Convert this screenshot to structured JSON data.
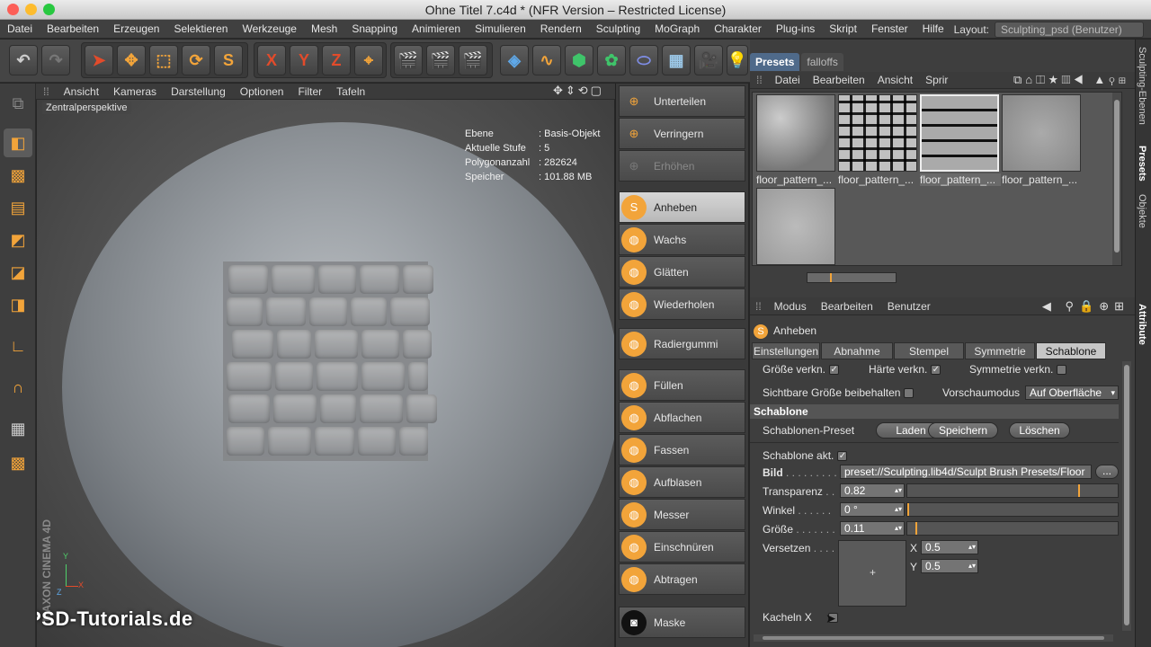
{
  "window": {
    "title": "Ohne Titel 7.c4d * (NFR Version – Restricted License)"
  },
  "menu": [
    "Datei",
    "Bearbeiten",
    "Erzeugen",
    "Selektieren",
    "Werkzeuge",
    "Mesh",
    "Snapping",
    "Animieren",
    "Simulieren",
    "Rendern",
    "Sculpting",
    "MoGraph",
    "Charakter",
    "Plug-ins",
    "Skript",
    "Fenster",
    "Hilfe"
  ],
  "layout": {
    "label": "Layout:",
    "value": "Sculpting_psd (Benutzer)"
  },
  "toolbar": {
    "x": "X",
    "y": "Y",
    "z": "Z"
  },
  "viewport": {
    "menu": [
      "Ansicht",
      "Kameras",
      "Darstellung",
      "Optionen",
      "Filter",
      "Tafeln"
    ],
    "camera": "Zentralperspektive",
    "hud": [
      {
        "k": "Ebene",
        "v": ": Basis-Objekt"
      },
      {
        "k": "Aktuelle Stufe",
        "v": ": 5"
      },
      {
        "k": "Polygonanzahl",
        "v": ": 282624"
      },
      {
        "k": "Speicher",
        "v": ": 101.88 MB"
      }
    ],
    "axes": {
      "y": "Y",
      "x": "X",
      "z": "Z"
    },
    "brand": "MAXON CINEMA 4D",
    "watermark": "PSD-Tutorials.de"
  },
  "sculpt_tools": [
    "Unterteilen",
    "Verringern",
    "Erhöhen",
    "Anheben",
    "Wachs",
    "Glätten",
    "Wiederholen",
    "Radiergummi",
    "Füllen",
    "Abflachen",
    "Fassen",
    "Aufblasen",
    "Messer",
    "Einschnüren",
    "Abtragen",
    "Maske"
  ],
  "active_tool": "Anheben",
  "presets": {
    "tabs": [
      "Presets",
      "falloffs"
    ],
    "menu": [
      "Datei",
      "Bearbeiten",
      "Ansicht",
      "Sprir"
    ],
    "items": [
      "floor_pattern_...",
      "floor_pattern_...",
      "floor_pattern_...",
      "floor_pattern_..."
    ]
  },
  "side_tabs": [
    "Sculpting-Ebenen",
    "Presets",
    "Objekte",
    "Attribute"
  ],
  "attributes": {
    "menu": [
      "Modus",
      "Bearbeiten",
      "Benutzer"
    ],
    "tool_name": "Anheben",
    "tabs": [
      "Einstellungen",
      "Abnahme",
      "Stempel",
      "Symmetrie",
      "Schablone"
    ],
    "active_tab": "Schablone",
    "groesse_verkn": "Größe verkn.",
    "haerte_verkn": "Härte verkn.",
    "symmetrie_verkn": "Symmetrie verkn.",
    "sichtbare": "Sichtbare Größe beibehalten",
    "vorschau_label": "Vorschaumodus",
    "vorschau_value": "Auf Oberfläche",
    "section": "Schablone",
    "preset_label": "Schablonen-Preset",
    "laden": "Laden",
    "speichern": "Speichern",
    "loeschen": "Löschen",
    "schablone_akt": "Schablone akt.",
    "bild_label": "Bild",
    "bild_value": "preset://Sculpting.lib4d/Sculpt Brush Presets/Floor",
    "browse": "...",
    "transparenz_label": "Transparenz",
    "transparenz": "0.82",
    "transparenz_level": 0.82,
    "winkel_label": "Winkel",
    "winkel": "0 °",
    "winkel_level": 0,
    "groesse_label": "Größe",
    "groesse": "0.11",
    "groesse_level": 0.04,
    "versetzen_label": "Versetzen",
    "x_label": "X",
    "x_value": "0.5",
    "y_label": "Y",
    "y_value": "0.5",
    "kacheln_label": "Kacheln X"
  },
  "colors": {
    "accent": "#f2a43a",
    "tab_active": "#4f6a8a"
  }
}
